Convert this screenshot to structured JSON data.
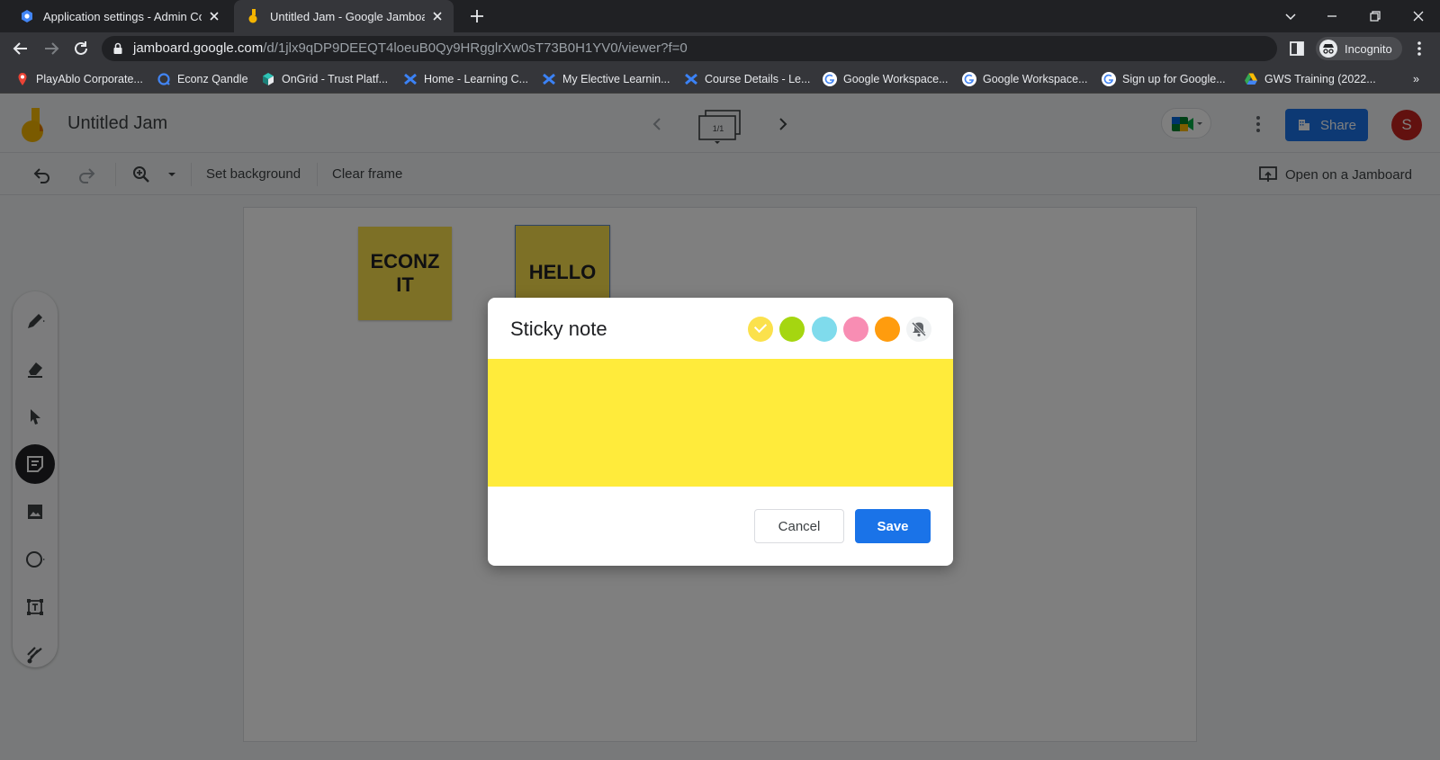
{
  "browser": {
    "tabs": [
      {
        "title": "Application settings - Admin Con",
        "active": false
      },
      {
        "title": "Untitled Jam - Google Jamboard",
        "active": true
      }
    ],
    "url_host": "jamboard.google.com",
    "url_path": "/d/1jlx9qDP9DEEQT4loeuB0Qy9HRgglrXw0sT73B0H1YV0/viewer?f=0",
    "incognito_label": "Incognito",
    "bookmarks": [
      "PlayAblo Corporate...",
      "Econz Qandle",
      "OnGrid - Trust Platf...",
      "Home - Learning C...",
      "My Elective Learnin...",
      "Course Details - Le...",
      "Google Workspace...",
      "Google Workspace...",
      "Sign up for Google...",
      "GWS Training (2022..."
    ],
    "bookmarks_overflow": "»"
  },
  "app": {
    "title": "Untitled Jam",
    "frame_counter": "1/1",
    "share_label": "Share",
    "avatar_initial": "S",
    "toolbar": {
      "set_background": "Set background",
      "clear_frame": "Clear frame",
      "open_on_jamboard": "Open on a Jamboard"
    },
    "notes": [
      {
        "text_line1": "ECONZ",
        "text_line2": "IT"
      },
      {
        "text_line1": "HELLO"
      }
    ]
  },
  "dialog": {
    "title": "Sticky note",
    "colors": [
      "#fbe14c",
      "#a5d610",
      "#7fdbec",
      "#f88db3",
      "#ff9c0e"
    ],
    "selected_color": "#fbe14c",
    "note_text": "",
    "cancel_label": "Cancel",
    "save_label": "Save"
  }
}
